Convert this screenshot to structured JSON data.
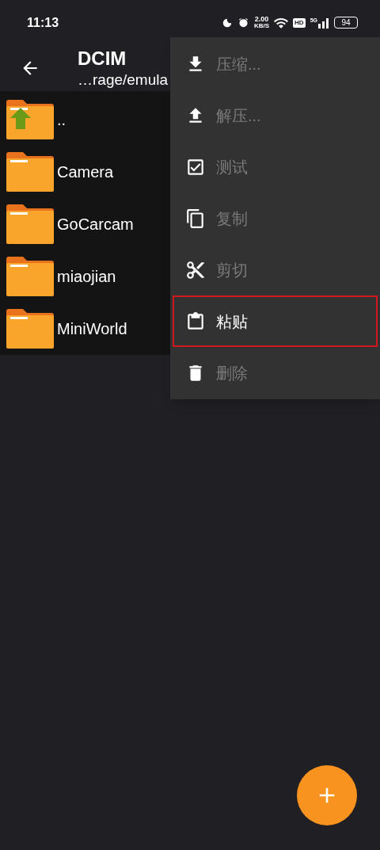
{
  "status_bar": {
    "time": "11:13",
    "speed_value": "2.00",
    "speed_unit": "KB/S",
    "hd": "HD",
    "network": "5G",
    "battery": "94"
  },
  "header": {
    "title": "DCIM",
    "path": "…rage/emula"
  },
  "files": [
    {
      "name": "..",
      "kind": "parent"
    },
    {
      "name": "Camera",
      "kind": "folder"
    },
    {
      "name": "GoCarcam",
      "kind": "folder"
    },
    {
      "name": "miaojian",
      "kind": "folder"
    },
    {
      "name": "MiniWorld",
      "kind": "folder"
    }
  ],
  "menu": [
    {
      "label": "压缩...",
      "kind": "compress",
      "disabled": true,
      "highlighted": false
    },
    {
      "label": "解压...",
      "kind": "extract",
      "disabled": true,
      "highlighted": false
    },
    {
      "label": "测试",
      "kind": "test",
      "disabled": true,
      "highlighted": false
    },
    {
      "label": "复制",
      "kind": "copy",
      "disabled": true,
      "highlighted": false
    },
    {
      "label": "剪切",
      "kind": "cut",
      "disabled": true,
      "highlighted": false
    },
    {
      "label": "粘贴",
      "kind": "paste",
      "disabled": false,
      "highlighted": true
    },
    {
      "label": "删除",
      "kind": "delete",
      "disabled": true,
      "highlighted": false
    }
  ]
}
